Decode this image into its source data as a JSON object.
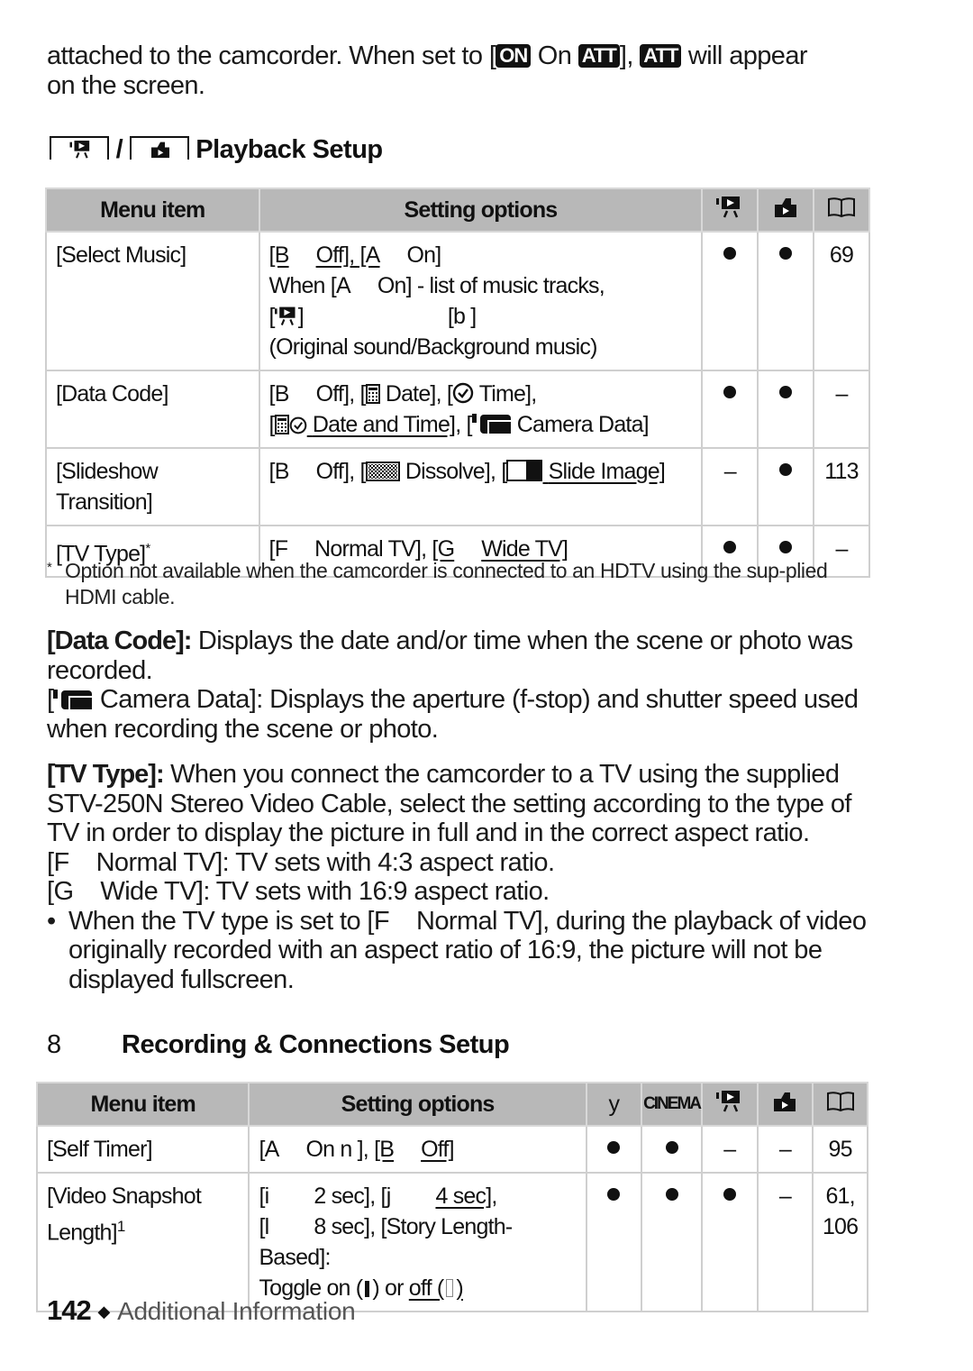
{
  "intro": {
    "line_prefix": "attached to the camcorder. When set to [",
    "on_badge": "ON",
    "on_label": "On",
    "att_badge": "ATT",
    "after_att": "],",
    "suffix": "will appear",
    "line2": "on the screen."
  },
  "playback_section": {
    "separator": "/",
    "title": "Playback Setup",
    "headers": {
      "menu_item": "Menu item",
      "setting_options": "Setting options"
    },
    "header_icons": [
      "movie-playback-icon",
      "photo-playback-icon",
      "reference-page-icon"
    ],
    "rows": [
      {
        "item": "[Select Music]",
        "options": [
          "[B",
          "Off], [A",
          "On]",
          "When [A",
          "On] - list of music tracks,",
          "[",
          "]",
          "[b ]",
          "(Original sound/Background music)"
        ],
        "movie": "dot",
        "photo": "dot",
        "page": "69"
      },
      {
        "item": "[Data Code]",
        "options": [
          "[B",
          "Off], [",
          "Date], [",
          "Time],",
          "[",
          "Date and Time]",
          ", [",
          "Camera Data]"
        ],
        "movie": "dot",
        "photo": "dot",
        "page": "–"
      },
      {
        "item": "[Slideshow Transition]",
        "options": [
          "[B",
          "Off], [",
          "Dissolve], ",
          "[",
          "Slide Image]"
        ],
        "movie": "–",
        "photo": "dot",
        "page": "113"
      },
      {
        "item": "[TV Type]",
        "item_sup": "*",
        "options": [
          "[F",
          "Normal TV], ",
          "[G",
          "Wide TV]"
        ],
        "movie": "dot",
        "photo": "dot",
        "page": "–"
      }
    ],
    "footnote_mark": "*",
    "footnote": "Option not available when the camcorder is connected to an HDTV using the sup-plied HDMI cable."
  },
  "data_code_desc": {
    "lead": "[Data Code]:",
    "text": " Displays the date and/or time when the scene or photo was recorded.",
    "camera_data_open": "[",
    "camera_data_text": " Camera Data]: Displays the aperture (f-stop) and shutter speed used when recording the scene or photo."
  },
  "tv_type_desc": {
    "lead": "[TV Type]:",
    "text": " When you connect the camcorder to a TV using the supplied STV-250N Stereo Video Cable, select the setting according to the type of TV in order to display the picture in full and in the correct aspect ratio.",
    "normal_prefix": "[F",
    "normal_text": "Normal TV]: TV sets with 4:3 aspect ratio.",
    "wide_prefix": "[G",
    "wide_text": "Wide TV]: TV sets with 16:9 aspect ratio.",
    "bullet": "•",
    "note_a": "When the TV type is set to [F",
    "note_b": "Normal TV], during the playback of video originally recorded with an aspect ratio of 16:9, the picture will not be displayed fullscreen."
  },
  "recording_section": {
    "icon_glyph": "8",
    "title": "Recording & Connections Setup",
    "headers": {
      "menu_item": "Menu item",
      "setting_options": "Setting options",
      "col_y": "y",
      "col_cinema": "CINEMA"
    },
    "rows": [
      {
        "item": "[Self Timer]",
        "options": [
          "[A",
          "On n ], ",
          "[B",
          "Off]"
        ],
        "y": "dot",
        "cinema": "dot",
        "movie": "–",
        "photo": "–",
        "page": "95"
      },
      {
        "item": "[Video Snapshot Length]",
        "item_sup": "1",
        "options": [
          "[i",
          "2 sec], ",
          "[j",
          "4 sec]",
          ",",
          "[l",
          "8 sec], [Story Length-Based]:",
          "Toggle on (",
          ") or ",
          "off (",
          ")"
        ],
        "y": "dot",
        "cinema": "dot",
        "movie": "dot",
        "photo": "–",
        "page_1": "61,",
        "page_2": "106"
      }
    ]
  },
  "footer": {
    "page_number": "142",
    "diamond": "◆",
    "section": "Additional Information"
  }
}
